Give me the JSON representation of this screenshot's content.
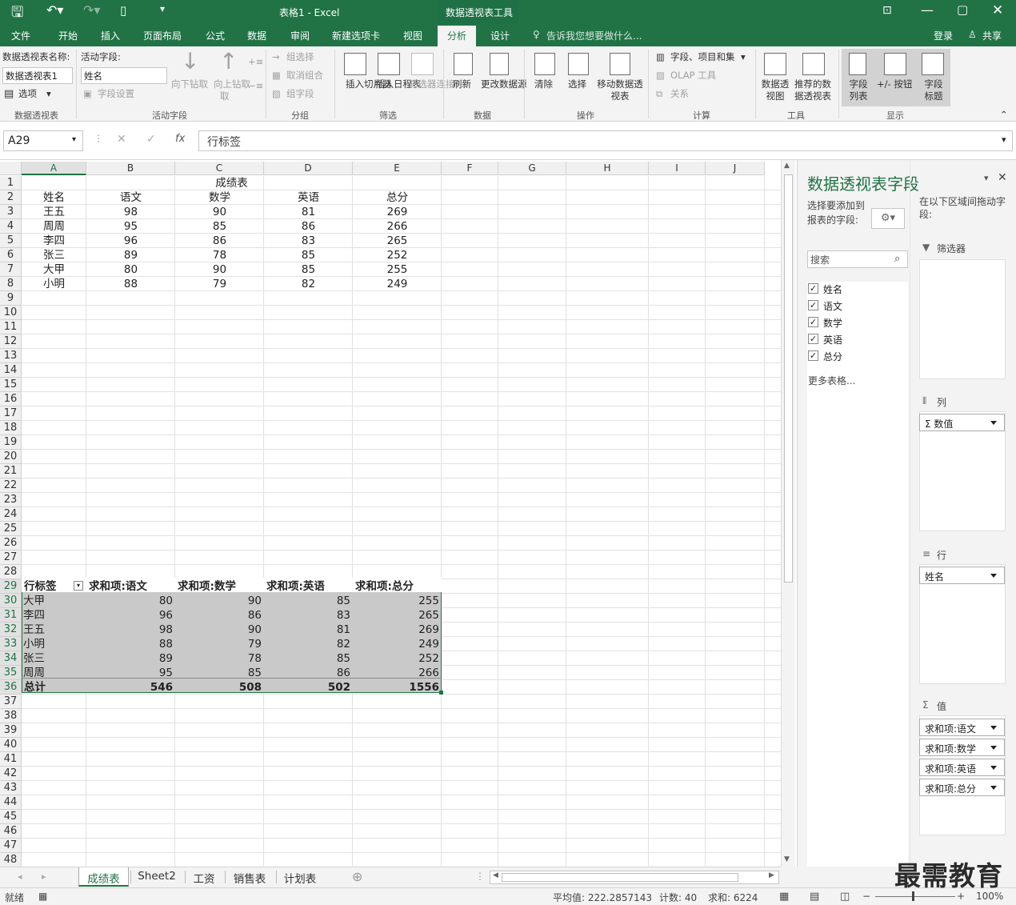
{
  "window": {
    "title": "表格1 - Excel",
    "context_tab": "数据透视表工具"
  },
  "menu": {
    "tabs": [
      "文件",
      "开始",
      "插入",
      "页面布局",
      "公式",
      "数据",
      "审阅",
      "新建选项卡",
      "视图",
      "分析",
      "设计"
    ],
    "active": "分析",
    "tell_me": "告诉我您想要做什么...",
    "login": "登录",
    "share": "共享"
  },
  "ribbon": {
    "pt_name_label": "数据透视表名称:",
    "pt_name_value": "数据透视表1",
    "options": "选项",
    "active_field_label": "活动字段:",
    "active_field_value": "姓名",
    "field_settings": "字段设置",
    "drill_down": "向下钻取",
    "drill_up": "向上钻取",
    "drill_up_2": "取",
    "group_selection": "组选择",
    "ungroup": "取消组合",
    "group_field": "组字段",
    "insert_slicer": "插入切片器",
    "insert_timeline": "插入日程表",
    "filter_connections": "筛选器连接",
    "refresh": "刷新",
    "change_source": "更改数据源",
    "clear": "清除",
    "select": "选择",
    "move_pivot": "移动数据透视表",
    "fields_items_sets": "字段、项目和集",
    "olap_tools": "OLAP 工具",
    "relationships": "关系",
    "pivot_chart": "数据透视图",
    "recommended": "推荐的数据透视表",
    "field_list": "字段列表",
    "plus_minus": "+/- 按钮",
    "field_headers": "字段标题",
    "groups": [
      "数据透视表",
      "活动字段",
      "分组",
      "筛选",
      "数据",
      "操作",
      "计算",
      "工具",
      "显示"
    ]
  },
  "formula": {
    "name_box": "A29",
    "content": "行标签"
  },
  "columns": [
    "A",
    "B",
    "C",
    "D",
    "E",
    "F",
    "G",
    "H",
    "I",
    "J"
  ],
  "source_table": {
    "title": "成绩表",
    "headers": [
      "姓名",
      "语文",
      "数学",
      "英语",
      "总分"
    ],
    "rows": [
      [
        "王五",
        "98",
        "90",
        "81",
        "269"
      ],
      [
        "周周",
        "95",
        "85",
        "86",
        "266"
      ],
      [
        "李四",
        "96",
        "86",
        "83",
        "265"
      ],
      [
        "张三",
        "89",
        "78",
        "85",
        "252"
      ],
      [
        "大甲",
        "80",
        "90",
        "85",
        "255"
      ],
      [
        "小明",
        "88",
        "79",
        "82",
        "249"
      ]
    ]
  },
  "pivot": {
    "headers": [
      "行标签",
      "求和项:语文",
      "求和项:数学",
      "求和项:英语",
      "求和项:总分"
    ],
    "rows": [
      [
        "大甲",
        "80",
        "90",
        "85",
        "255"
      ],
      [
        "李四",
        "96",
        "86",
        "83",
        "265"
      ],
      [
        "王五",
        "98",
        "90",
        "81",
        "269"
      ],
      [
        "小明",
        "88",
        "79",
        "82",
        "249"
      ],
      [
        "张三",
        "89",
        "78",
        "85",
        "252"
      ],
      [
        "周周",
        "95",
        "85",
        "86",
        "266"
      ]
    ],
    "total": [
      "总计",
      "546",
      "508",
      "502",
      "1556"
    ]
  },
  "pane": {
    "title": "数据透视表字段",
    "choose_label": "选择要添加到报表的字段:",
    "drag_label": "在以下区域间拖动字段:",
    "search_placeholder": "搜索",
    "fields": [
      "姓名",
      "语文",
      "数学",
      "英语",
      "总分"
    ],
    "more_tables": "更多表格...",
    "filters_label": "筛选器",
    "columns_label": "列",
    "columns_items": [
      "Σ 数值"
    ],
    "rows_label": "行",
    "rows_items": [
      "姓名"
    ],
    "values_label": "值",
    "values_items": [
      "求和项:语文",
      "求和项:数学",
      "求和项:英语",
      "求和项:总分"
    ]
  },
  "sheets": {
    "tabs": [
      "成绩表",
      "Sheet2",
      "工资",
      "销售表",
      "计划表"
    ],
    "active": "成绩表"
  },
  "status": {
    "ready": "就绪",
    "average": "平均值: 222.2857143",
    "count": "计数: 40",
    "sum": "求和: 6224",
    "zoom": "100%"
  },
  "watermark": "最需教育",
  "colors": {
    "excel_green": "#217346",
    "pivot_fill": "#c9c9c9",
    "ribbon_bg": "#f3f3f3"
  }
}
